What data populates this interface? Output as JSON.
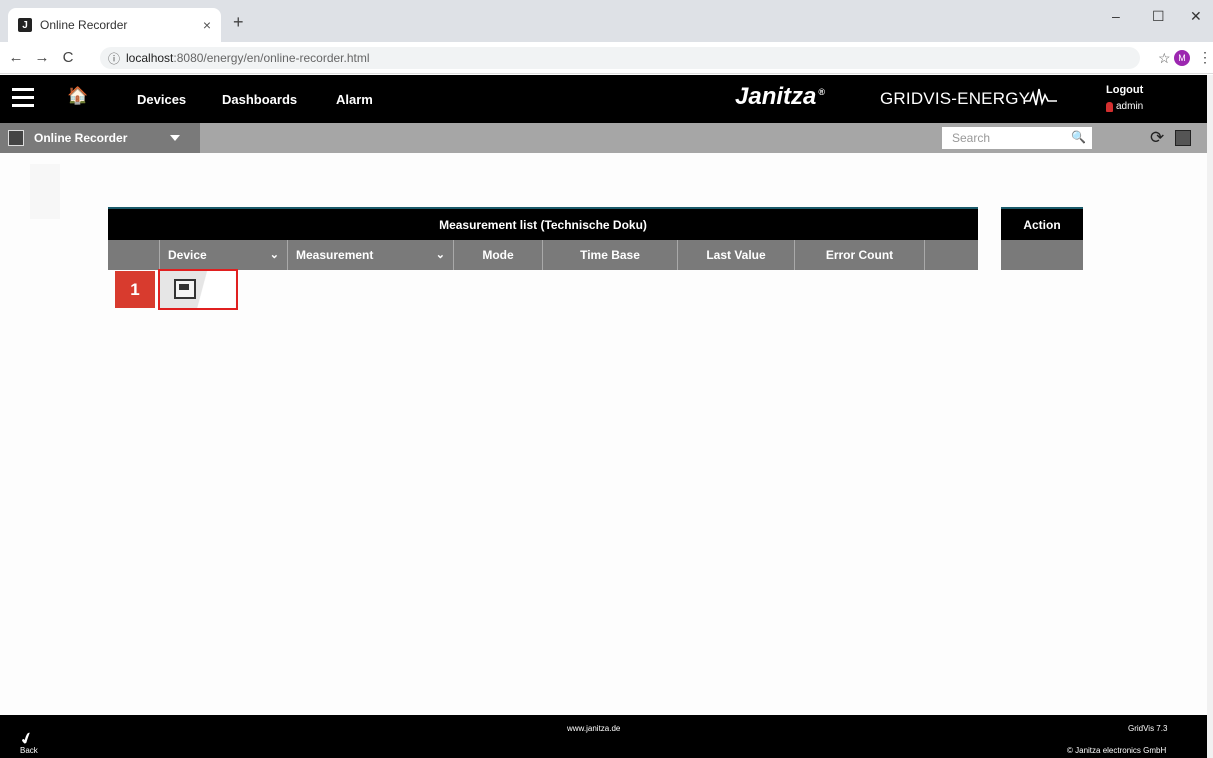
{
  "browser": {
    "tab_title": "Online Recorder",
    "tab_close": "×",
    "new_tab": "+",
    "url_host": "localhost",
    "url_rest": ":8080/energy/en/online-recorder.html",
    "back": "←",
    "forward": "→",
    "reload": "C",
    "info": "ⓘ",
    "star": "☆",
    "profile_initial": "M",
    "menu": "⋮",
    "minimize": "–",
    "maximize": "☐",
    "close": "✕"
  },
  "appbar": {
    "home_icon": "🏠",
    "menu": [
      "Devices",
      "Dashboards",
      "Alarm"
    ],
    "brand": "Janitza",
    "brand_reg": "®",
    "brand_sub": "GRIDVIS-ENERGY",
    "logout": "Logout",
    "user": "admin"
  },
  "subbar": {
    "title": "Online Recorder",
    "search_placeholder": "Search",
    "search_icon": "🔍",
    "refresh_icon": "⟳"
  },
  "table": {
    "title": "Measurement list (Technische Doku)",
    "columns": [
      "Device",
      "Measurement",
      "Mode",
      "Time Base",
      "Last Value",
      "Error Count"
    ],
    "chevron": "⌄",
    "action_title": "Action"
  },
  "annotation": {
    "step": "1"
  },
  "footer": {
    "back": "Back",
    "link": "www.janitza.de",
    "version": "GridVis 7.3",
    "copyright": "© Janitza electronics GmbH"
  }
}
